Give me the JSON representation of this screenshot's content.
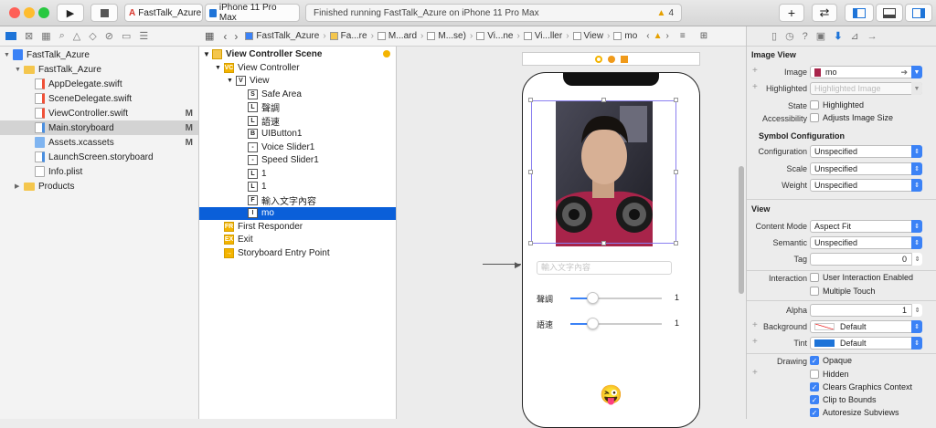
{
  "toolbar": {
    "scheme_name": "FastTalk_Azure",
    "device": "iPhone 11 Pro Max",
    "status": "Finished running FastTalk_Azure on iPhone 11 Pro Max",
    "warning_count": "4",
    "add": "+",
    "swap": "⇄"
  },
  "navigator": {
    "items": [
      {
        "label": "FastTalk_Azure",
        "kind": "proj",
        "level": 0,
        "disclosure": "▼",
        "mark": ""
      },
      {
        "label": "FastTalk_Azure",
        "kind": "folder",
        "level": 1,
        "disclosure": "▼",
        "mark": ""
      },
      {
        "label": "AppDelegate.swift",
        "kind": "swift",
        "level": 2,
        "disclosure": "",
        "mark": ""
      },
      {
        "label": "SceneDelegate.swift",
        "kind": "swift",
        "level": 2,
        "disclosure": "",
        "mark": ""
      },
      {
        "label": "ViewController.swift",
        "kind": "swift",
        "level": 2,
        "disclosure": "",
        "mark": "M"
      },
      {
        "label": "Main.storyboard",
        "kind": "sb",
        "level": 2,
        "disclosure": "",
        "mark": "M"
      },
      {
        "label": "Assets.xcassets",
        "kind": "assets",
        "level": 2,
        "disclosure": "",
        "mark": "M"
      },
      {
        "label": "LaunchScreen.storyboard",
        "kind": "sb",
        "level": 2,
        "disclosure": "",
        "mark": ""
      },
      {
        "label": "Info.plist",
        "kind": "doc",
        "level": 2,
        "disclosure": "",
        "mark": ""
      },
      {
        "label": "Products",
        "kind": "folder",
        "level": 1,
        "disclosure": "▶",
        "mark": ""
      }
    ]
  },
  "jumpbar": [
    "FastTalk_Azure",
    "Fa...re",
    "M...ard",
    "M...se)",
    "Vi...ne",
    "Vi...ller",
    "View",
    "mo"
  ],
  "outline": {
    "scene_title": "View Controller Scene",
    "items": [
      {
        "label": "View Controller",
        "badge": "VC",
        "level": 1
      },
      {
        "label": "View",
        "badge": "V",
        "level": 2
      },
      {
        "label": "Safe Area",
        "badge": "S",
        "level": 3
      },
      {
        "label": "聲調",
        "badge": "L",
        "level": 3
      },
      {
        "label": "語速",
        "badge": "L",
        "level": 3
      },
      {
        "label": "UIButton1",
        "badge": "B",
        "level": 3
      },
      {
        "label": "Voice Slider1",
        "badge": "-",
        "level": 3
      },
      {
        "label": "Speed Slider1",
        "badge": "-",
        "level": 3
      },
      {
        "label": "1",
        "badge": "L",
        "level": 3
      },
      {
        "label": "1",
        "badge": "L",
        "level": 3
      },
      {
        "label": "輸入文字內容",
        "badge": "F",
        "level": 3
      },
      {
        "label": "mo",
        "badge": "I",
        "level": 3
      },
      {
        "label": "First Responder",
        "badge": "FR",
        "level": 1
      },
      {
        "label": "Exit",
        "badge": "EX",
        "level": 1
      },
      {
        "label": "Storyboard Entry Point",
        "badge": "→",
        "level": 1
      }
    ]
  },
  "canvas": {
    "text_placeholder": "輸入文字內容",
    "pitch_label": "聲調",
    "pitch_value": "1",
    "speed_label": "語速",
    "speed_value": "1",
    "emoji": "😜"
  },
  "inspector": {
    "image_view_title": "Image View",
    "image_label": "Image",
    "image_value": "mo",
    "highlighted_label": "Highlighted",
    "highlighted_placeholder": "Highlighted Image",
    "state_label": "State",
    "state_value": "Highlighted",
    "accessibility_label": "Accessibility",
    "accessibility_value": "Adjusts Image Size",
    "symbol_title": "Symbol Configuration",
    "configuration_label": "Configuration",
    "configuration_value": "Unspecified",
    "scale_label": "Scale",
    "scale_value": "Unspecified",
    "weight_label": "Weight",
    "weight_value": "Unspecified",
    "view_title": "View",
    "content_mode_label": "Content Mode",
    "content_mode_value": "Aspect Fit",
    "semantic_label": "Semantic",
    "semantic_value": "Unspecified",
    "tag_label": "Tag",
    "tag_value": "0",
    "interaction_label": "Interaction",
    "interaction_value": "User Interaction Enabled",
    "multiple_touch": "Multiple Touch",
    "alpha_label": "Alpha",
    "alpha_value": "1",
    "background_label": "Background",
    "background_value": "Default",
    "tint_label": "Tint",
    "tint_value": "Default",
    "drawing_label": "Drawing",
    "opaque": "Opaque",
    "hidden": "Hidden",
    "clears_graphics": "Clears Graphics Context",
    "clip_bounds": "Clip to Bounds",
    "autoresize": "Autoresize Subviews"
  },
  "colors": {
    "accent": "#3b82f6",
    "selection": "#0a5fd9"
  }
}
